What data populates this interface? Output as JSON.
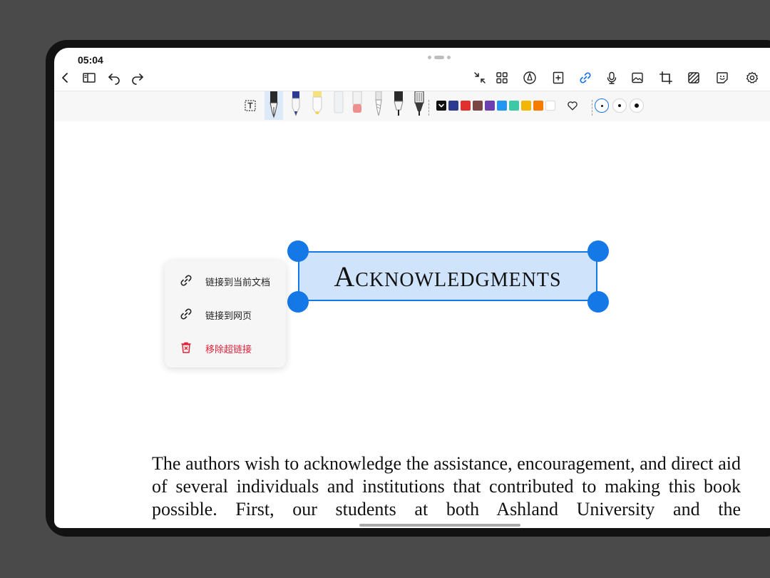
{
  "status_bar": {
    "time": "05:04"
  },
  "top_toolbar": {
    "left_icons": [
      "back-icon",
      "sidebar-icon",
      "undo-icon",
      "redo-icon"
    ],
    "right_icons": [
      "collapse-icon",
      "grid-icon",
      "pen-tool-icon",
      "add-page-icon",
      "link-icon",
      "microphone-icon",
      "image-icon",
      "crop-icon",
      "hatch-icon",
      "sticker-icon",
      "settings-icon"
    ],
    "active_icon": "link-icon",
    "accent_color": "#1a73e8"
  },
  "pen_toolbar": {
    "tools": [
      "text-box-tool",
      "fountain-pen",
      "ballpoint-pen",
      "highlighter-yellow",
      "highlighter-clear",
      "eraser",
      "brush-pen",
      "fineliner",
      "marker"
    ],
    "selected_tool": "fountain-pen",
    "colors": [
      "#111111",
      "#2c3a8f",
      "#e03030",
      "#7a4545",
      "#6b3fb0",
      "#2196f3",
      "#3ec9a6",
      "#f2b705",
      "#f57c00",
      "#ffffff"
    ],
    "selected_color": "#111111",
    "stroke_sizes": [
      "small",
      "medium",
      "large"
    ],
    "selected_size": "small"
  },
  "document": {
    "heading": "Acknowledgments",
    "body": "The authors wish to acknowledge the assistance, encouragement, and direct aid of several individuals and institutions that contributed to making this book possible. First, our students at both Ashland University and the"
  },
  "context_menu": {
    "items": [
      {
        "label": "链接到当前文档",
        "icon": "link-icon"
      },
      {
        "label": "链接到网页",
        "icon": "link-icon"
      },
      {
        "label": "移除超链接",
        "icon": "delete-icon",
        "danger": true
      }
    ],
    "danger_color": "#e0243a"
  }
}
